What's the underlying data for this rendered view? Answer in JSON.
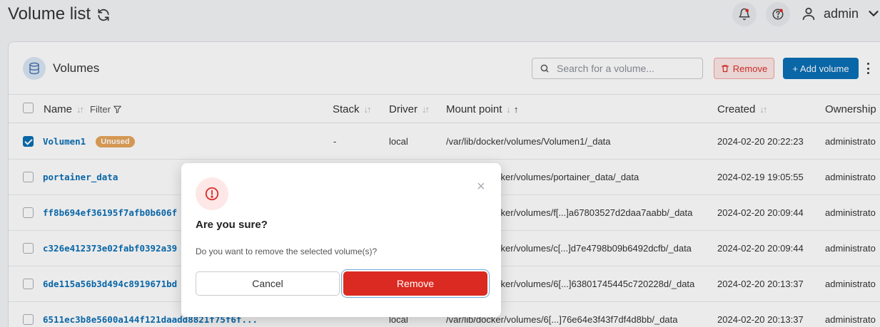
{
  "header": {
    "title": "Volume list",
    "user_name": "admin"
  },
  "card": {
    "title": "Volumes",
    "search_placeholder": "Search for a volume...",
    "remove_label": "Remove",
    "add_label": "+ Add volume"
  },
  "table": {
    "columns": {
      "name": "Name",
      "filter": "Filter",
      "stack": "Stack",
      "driver": "Driver",
      "mount": "Mount point",
      "created": "Created",
      "ownership": "Ownership"
    },
    "rows": [
      {
        "name": "Volumen1",
        "badge": "Unused",
        "stack": "-",
        "driver": "local",
        "mount": "/var/lib/docker/volumes/Volumen1/_data",
        "created": "2024-02-20 20:22:23",
        "ownership": "administrato",
        "checked": true
      },
      {
        "name": "portainer_data",
        "badge": "",
        "stack": "",
        "driver": "",
        "mount": "cker/volumes/portainer_data/_data",
        "created": "2024-02-19 19:05:55",
        "ownership": "administrato",
        "checked": false
      },
      {
        "name": "ff8b694ef36195f7afb0b606f",
        "badge": "",
        "stack": "",
        "driver": "",
        "mount": "cker/volumes/f[...]a67803527d2daa7aabb/_data",
        "created": "2024-02-20 20:09:44",
        "ownership": "administrato",
        "checked": false
      },
      {
        "name": "c326e412373e02fabf0392a39",
        "badge": "",
        "stack": "",
        "driver": "",
        "mount": "cker/volumes/c[...]d7e4798b09b6492dcfb/_data",
        "created": "2024-02-20 20:09:44",
        "ownership": "administrato",
        "checked": false
      },
      {
        "name": "6de115a56b3d494c8919671bd",
        "badge": "",
        "stack": "",
        "driver": "",
        "mount": "cker/volumes/6[...]63801745445c720228d/_data",
        "created": "2024-02-20 20:13:37",
        "ownership": "administrato",
        "checked": false
      },
      {
        "name": "6511ec3b8e5600a144f121daadd8821f75f6f...",
        "badge": "",
        "stack": "",
        "driver": "local",
        "mount": "/var/lib/docker/volumes/6[...]76e64e3f43f7df4d8bb/_data",
        "created": "2024-02-20 20:13:37",
        "ownership": "administrato",
        "checked": false
      }
    ]
  },
  "modal": {
    "title": "Are you sure?",
    "message": "Do you want to remove the selected volume(s)?",
    "cancel_label": "Cancel",
    "confirm_label": "Remove",
    "close_glyph": "×"
  },
  "colors": {
    "primary": "#0a6fb6",
    "danger": "#db2a21",
    "warning_badge": "#e6a45a"
  }
}
